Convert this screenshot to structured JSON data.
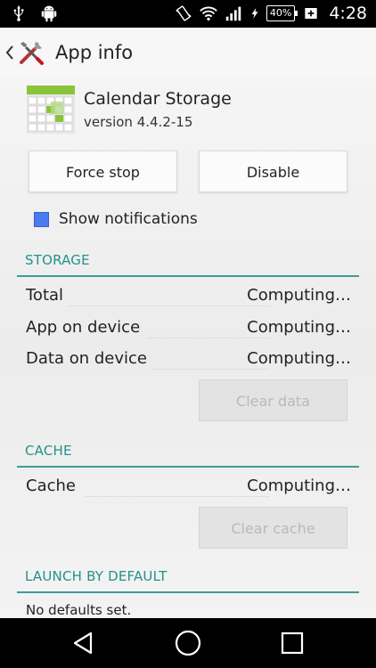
{
  "status_bar": {
    "battery": "40%",
    "time": "4:28"
  },
  "action_bar": {
    "title": "App info"
  },
  "app": {
    "name": "Calendar Storage",
    "version": "version 4.4.2-15"
  },
  "buttons": {
    "force_stop": "Force stop",
    "disable": "Disable",
    "clear_data": "Clear data",
    "clear_cache": "Clear cache"
  },
  "notifications": {
    "label": "Show notifications",
    "checked": true
  },
  "storage": {
    "header": "STORAGE",
    "rows": [
      {
        "label": "Total",
        "value": "Computing…"
      },
      {
        "label": "App on device",
        "value": "Computing…"
      },
      {
        "label": "Data on device",
        "value": "Computing…"
      }
    ]
  },
  "cache": {
    "header": "CACHE",
    "rows": [
      {
        "label": "Cache",
        "value": "Computing…"
      }
    ]
  },
  "launch": {
    "header": "LAUNCH BY DEFAULT",
    "text": "No defaults set."
  },
  "colors": {
    "accent": "#25918a",
    "checkbox": "#4a7bf0"
  }
}
